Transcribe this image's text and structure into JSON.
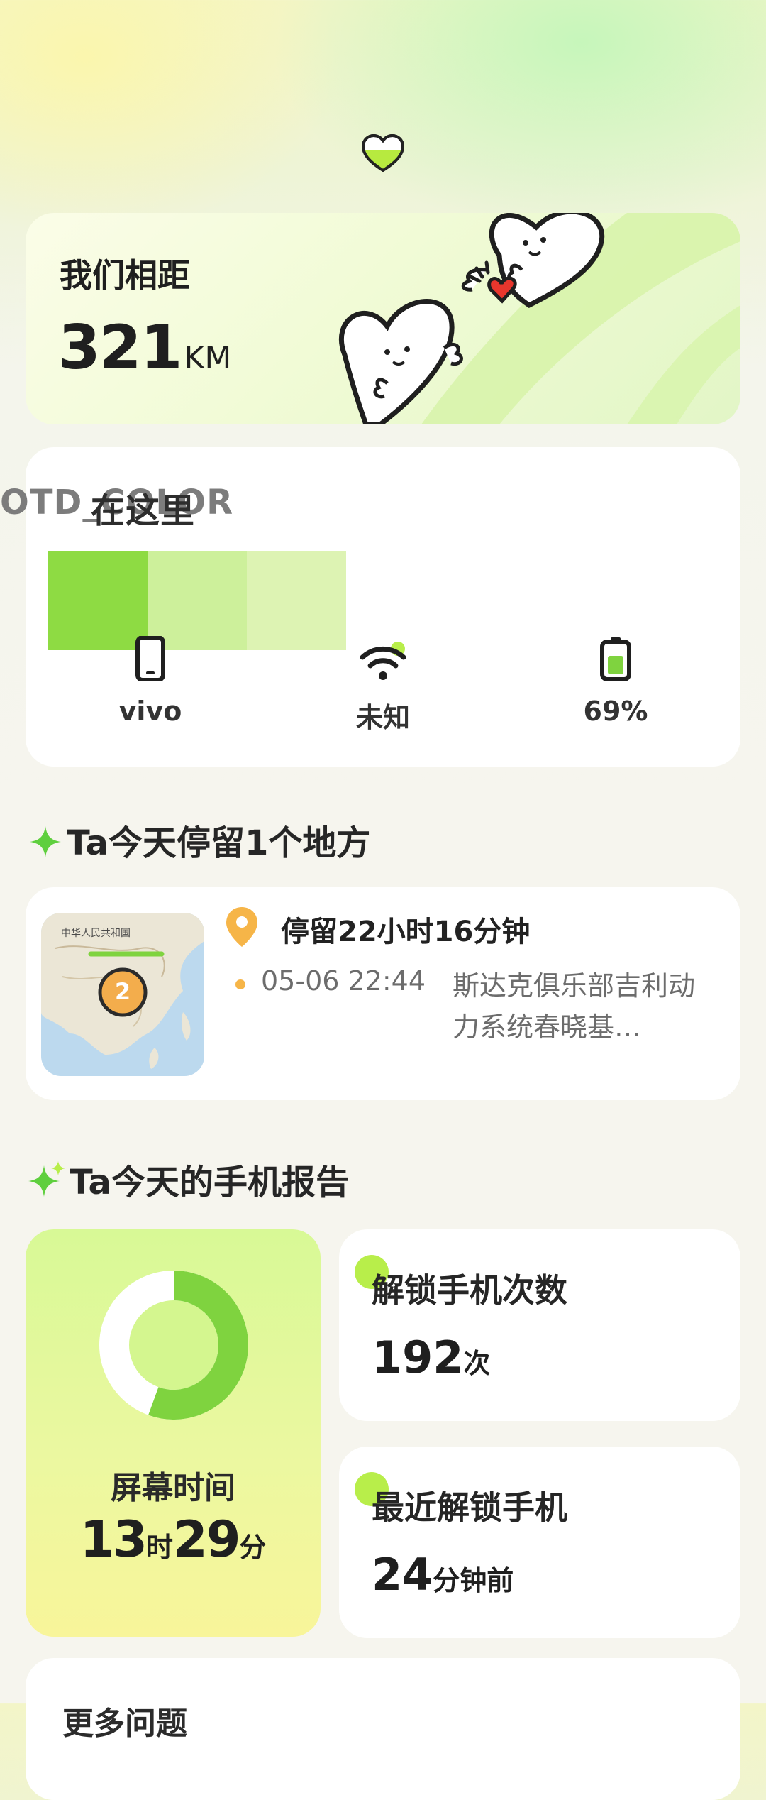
{
  "distance": {
    "title": "我们相距",
    "value": "321",
    "unit": "KM"
  },
  "device": {
    "title": "在这里",
    "ghost_text": "OTD_COLOR",
    "color_swatches": [
      "#8edb43",
      "#cdf09b",
      "#ddf3b3"
    ],
    "items": [
      {
        "icon": "phone-icon",
        "label": "vivo"
      },
      {
        "icon": "wifi-icon",
        "label": "未知"
      },
      {
        "icon": "battery-icon",
        "label": "69%"
      }
    ],
    "battery_level": 0.69
  },
  "places": {
    "title": "Ta今天停留1个地方",
    "map_label": "中华人民共和国",
    "map_badge": "2",
    "duration": "停留22小时16分钟",
    "time": "05-06 22:44",
    "place": "斯达克俱乐部吉利动力系统春晓基…"
  },
  "report": {
    "title": "Ta今天的手机报告",
    "screen_time_label": "屏幕时间",
    "screen_time_hours": "13",
    "hour_unit": "时",
    "screen_time_minutes": "29",
    "minute_unit": "分",
    "unlock_count_label": "解锁手机次数",
    "unlock_count": "192",
    "unlock_count_unit": "次",
    "last_unlock_label": "最近解锁手机",
    "last_unlock_value": "24",
    "last_unlock_unit": "分钟前"
  },
  "colors": {
    "accent_green": "#7fd33f",
    "light_green": "#d4f68f",
    "orange": "#f6b548"
  },
  "bottom_peek": "更多问题"
}
